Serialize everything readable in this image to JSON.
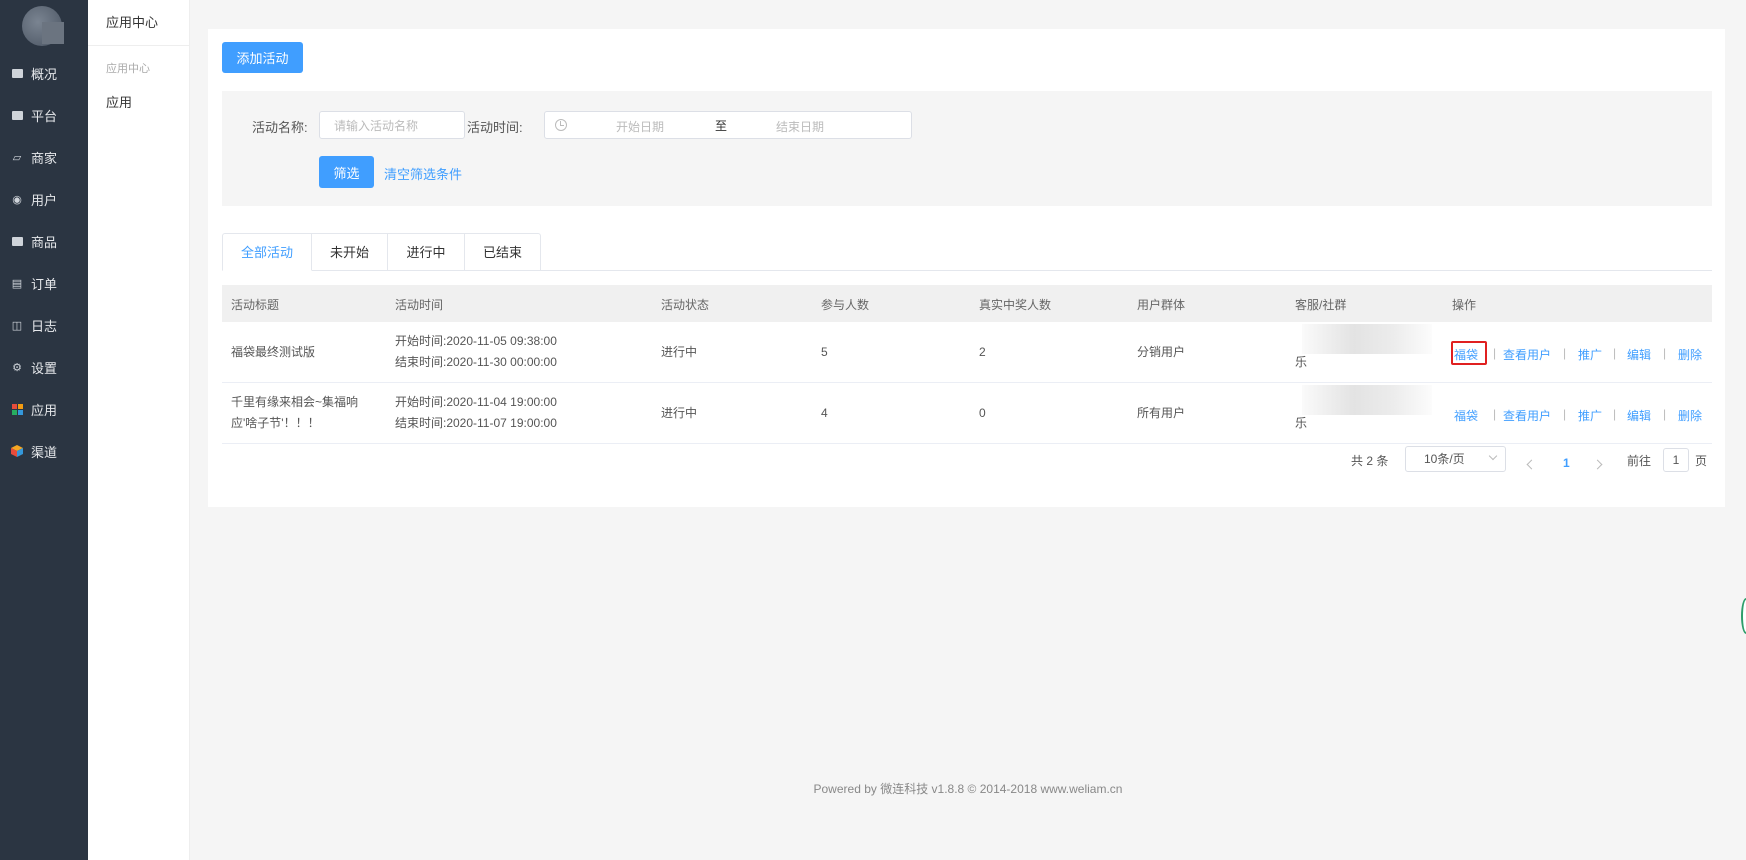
{
  "leftnav": {
    "items": [
      {
        "label": "概况",
        "icon": "monitor-icon"
      },
      {
        "label": "平台",
        "icon": "display-icon"
      },
      {
        "label": "商家",
        "icon": "store-icon"
      },
      {
        "label": "用户",
        "icon": "user-icon"
      },
      {
        "label": "商品",
        "icon": "goods-icon"
      },
      {
        "label": "订单",
        "icon": "order-icon"
      },
      {
        "label": "日志",
        "icon": "log-icon"
      },
      {
        "label": "设置",
        "icon": "gear-icon"
      },
      {
        "label": "应用",
        "icon": "apps-grid-icon"
      },
      {
        "label": "渠道",
        "icon": "cube-icon"
      }
    ]
  },
  "subnav": {
    "title": "应用中心",
    "group": "应用中心",
    "link": "应用"
  },
  "toolbar": {
    "add_label": "添加活动"
  },
  "filter": {
    "name_label": "活动名称:",
    "name_placeholder": "请输入活动名称",
    "time_label": "活动时间:",
    "start_placeholder": "开始日期",
    "separator": "至",
    "end_placeholder": "结束日期",
    "filter_button": "筛选",
    "clear_link": "清空筛选条件"
  },
  "tabs": [
    "全部活动",
    "未开始",
    "进行中",
    "已结束"
  ],
  "active_tab": "全部活动",
  "table": {
    "headers": [
      "活动标题",
      "活动时间",
      "活动状态",
      "参与人数",
      "真实中奖人数",
      "用户群体",
      "客服/社群",
      "操作"
    ],
    "rows": [
      {
        "title": [
          "福袋最终测试版",
          ""
        ],
        "start": "开始时间:2020-11-05 09:38:00",
        "end": "结束时间:2020-11-30 00:00:00",
        "status": "进行中",
        "participants": "5",
        "winners": "2",
        "group": "分销用户",
        "service": "乐"
      },
      {
        "title": [
          "千里有缘来相会~集福响",
          "应'啥子节'！！！"
        ],
        "start": "开始时间:2020-11-04 19:00:00",
        "end": "结束时间:2020-11-07 19:00:00",
        "status": "进行中",
        "participants": "4",
        "winners": "0",
        "group": "所有用户",
        "service": "乐"
      }
    ],
    "actions": [
      "福袋",
      "查看用户",
      "推广",
      "编辑",
      "删除"
    ],
    "action_sep": "|"
  },
  "pagination": {
    "total": "共 2 条",
    "page_size": "10条/页",
    "current": "1",
    "goto_prefix": "前往",
    "goto_value": "1",
    "goto_suffix": "页"
  },
  "footer": "Powered by 微连科技 v1.8.8 © 2014-2018 www.weliam.cn",
  "colors": {
    "sidebar_bg": "#2b3542",
    "primary": "#409eff",
    "highlight": "#e02020"
  }
}
